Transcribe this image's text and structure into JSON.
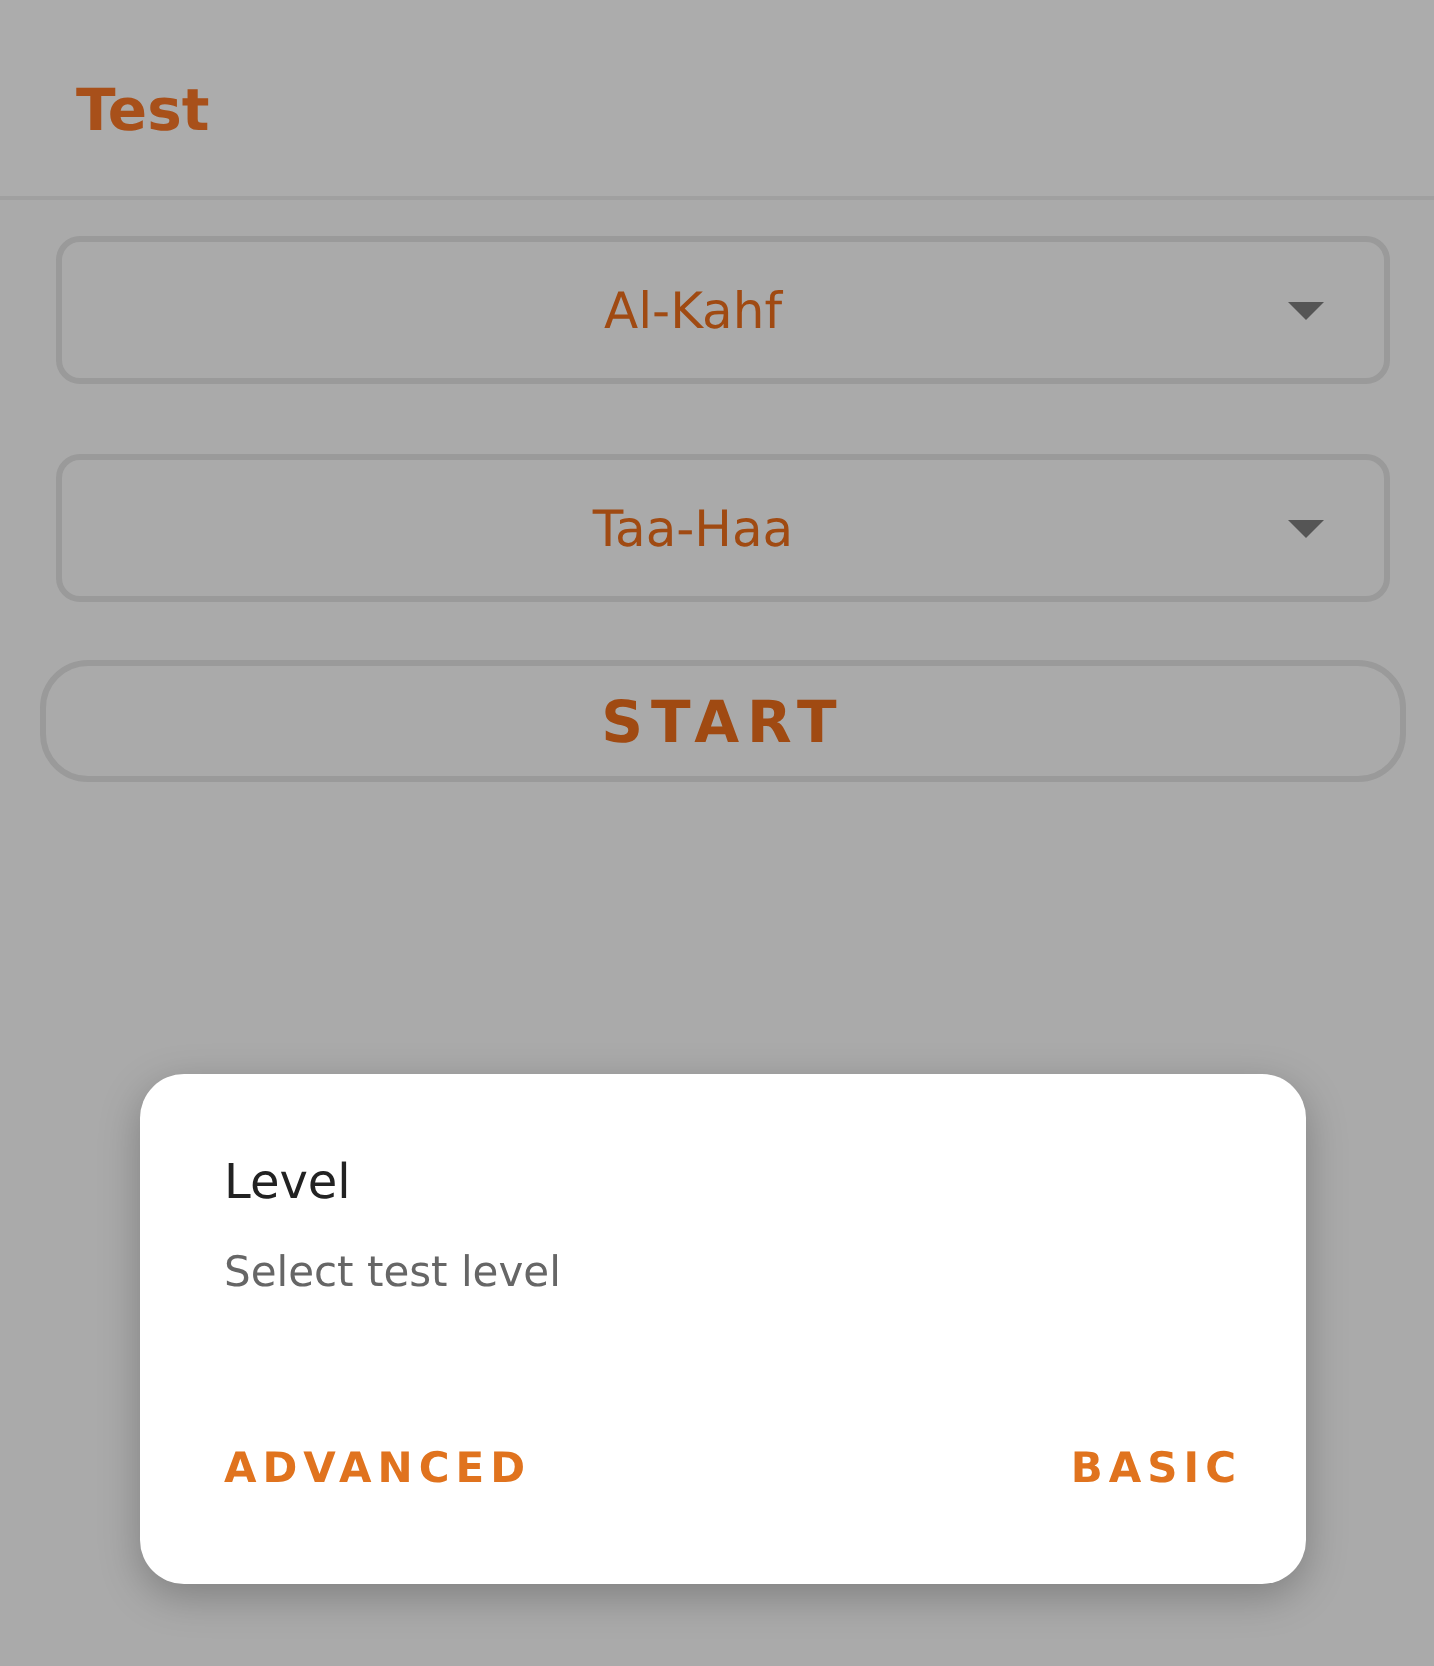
{
  "app_bar": {
    "title": "Test"
  },
  "dropdowns": [
    {
      "value": "Al-Kahf"
    },
    {
      "value": "Taa-Haa"
    }
  ],
  "start_button": {
    "label": "START"
  },
  "dialog": {
    "title": "Level",
    "message": "Select test level",
    "buttons": [
      "ADVANCED",
      "BASIC"
    ]
  }
}
